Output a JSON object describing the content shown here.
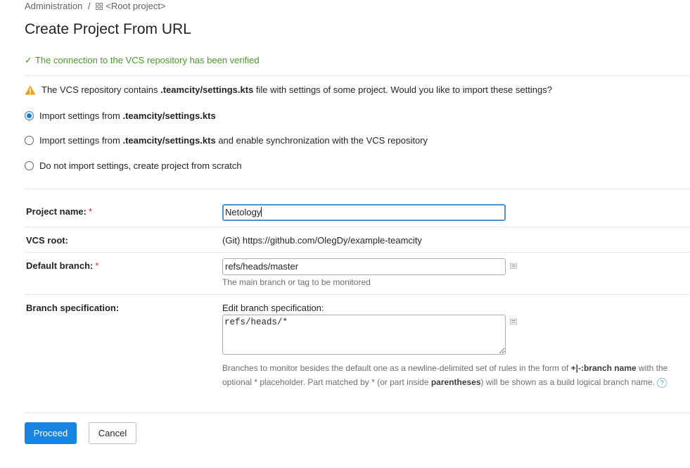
{
  "breadcrumb": {
    "root": "Administration",
    "separator": "/",
    "project": "<Root project>",
    "project_icon": "grid-icon"
  },
  "page": {
    "title": "Create Project From URL"
  },
  "status": {
    "verified_icon": "checkmark",
    "verified_text": "The connection to the VCS repository has been verified",
    "verified_color": "#4b9a2b"
  },
  "warning": {
    "icon": "warning-triangle",
    "prefix": "The VCS repository contains ",
    "file": ".teamcity/settings.kts",
    "suffix": " file with settings of some project. Would you like to import these settings?"
  },
  "import_options": [
    {
      "prefix": "Import settings from ",
      "bold": ".teamcity/settings.kts",
      "suffix": "",
      "checked": true
    },
    {
      "prefix": "Import settings from ",
      "bold": ".teamcity/settings.kts",
      "suffix": " and enable synchronization with the VCS repository",
      "checked": false
    },
    {
      "prefix": "Do not import settings, create project from scratch",
      "bold": "",
      "suffix": "",
      "checked": false
    }
  ],
  "form": {
    "required_marker": "*",
    "project_name": {
      "label": "Project name:",
      "value": "Netology"
    },
    "vcs_root": {
      "label": "VCS root:",
      "value": "(Git) https://github.com/OlegDy/example-teamcity"
    },
    "default_branch": {
      "label": "Default branch:",
      "value": "refs/heads/master",
      "note": "The main branch or tag to be monitored"
    },
    "branch_spec": {
      "label": "Branch specification:",
      "edit_label": "Edit branch specification:",
      "value": "refs/heads/*",
      "note_parts": {
        "p1": "Branches to monitor besides the default one as a newline-delimited set of rules in the form of ",
        "b1": "+|-:branch name",
        "p2": " with the optional * placeholder. Part matched by * (or part inside ",
        "b2": "parentheses",
        "p3": ") will be shown as a build logical branch name."
      },
      "help_icon": "?"
    }
  },
  "buttons": {
    "proceed": "Proceed",
    "cancel": "Cancel"
  },
  "colors": {
    "accent": "#1a84e3",
    "required": "#c62828",
    "focus": "#4c94d8",
    "warning": "#e8a317"
  }
}
